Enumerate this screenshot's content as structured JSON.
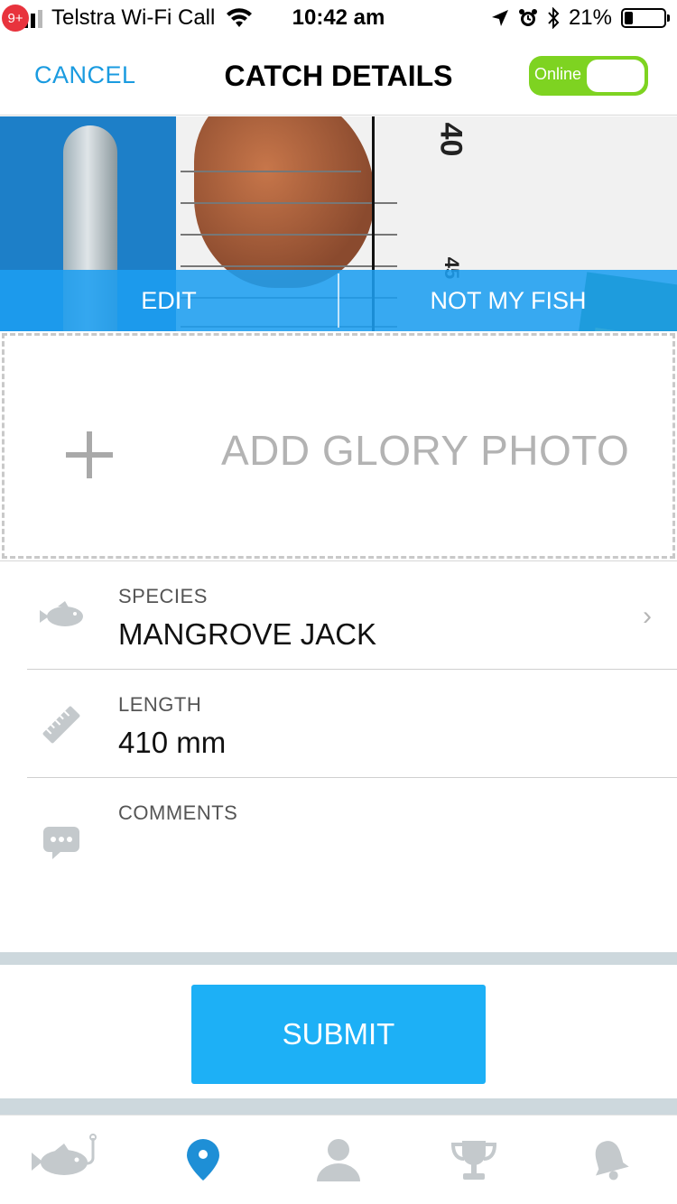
{
  "status_bar": {
    "notification_badge": "9+",
    "carrier": "Telstra Wi-Fi Call",
    "time": "10:42 am",
    "battery": "21%",
    "battery_level": 0.21
  },
  "header": {
    "cancel_label": "CANCEL",
    "title": "CATCH DETAILS",
    "toggle_label": "Online"
  },
  "photo": {
    "ruler_marks": [
      "40",
      "45"
    ],
    "edit_label": "EDIT",
    "not_my_fish_label": "NOT MY FISH"
  },
  "glory_photo": {
    "label": "ADD GLORY PHOTO"
  },
  "form": {
    "species": {
      "label": "SPECIES",
      "value": "MANGROVE JACK"
    },
    "length": {
      "label": "LENGTH",
      "value": "410 mm"
    },
    "comments": {
      "label": "COMMENTS",
      "value": ""
    }
  },
  "submit_label": "SUBMIT",
  "tabs": [
    "fish-hook-icon",
    "location-pin-icon",
    "profile-icon",
    "trophy-icon",
    "bell-icon"
  ],
  "colors": {
    "accent": "#1a9be0",
    "submit": "#1db0f6",
    "toggle": "#7ed321",
    "icon_gray": "#c4c9cc",
    "active_tab": "#1e8fd6"
  }
}
